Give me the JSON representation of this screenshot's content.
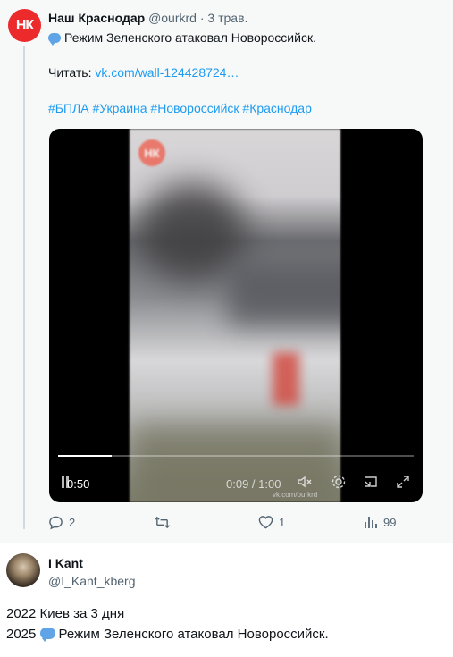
{
  "quoted_tweet": {
    "avatar_text": "НК",
    "author_name": "Наш Краснодар",
    "author_handle": "@ourkrd",
    "timestamp": "· 3 трав.",
    "text": "Режим Зеленского атаковал Новороссийск.",
    "read_label": "Читать:",
    "read_link": "vk.com/wall-124428724…",
    "hashtags": "#БПЛА #Украина #Новороссийск #Краснодар",
    "video": {
      "watermark_text": "НК",
      "duration": "0:50",
      "timecode": "0:09 / 1:00",
      "progress": 0.15,
      "vk_watermark": "vk.com/ourkrd"
    },
    "actions": {
      "replies": "2",
      "retweets": "",
      "likes": "1",
      "views": "99"
    }
  },
  "reply_tweet": {
    "author_name": "I Kant",
    "author_handle": "@I_Kant_kberg",
    "line1": "2022 Киев за 3 дня",
    "line2_year": "2025",
    "line2_text": "Режим Зеленского атаковал Новороссийск."
  },
  "colors": {
    "brand_red": "#ec2a2c",
    "link_blue": "#1d9bf0",
    "muted": "#536471"
  }
}
